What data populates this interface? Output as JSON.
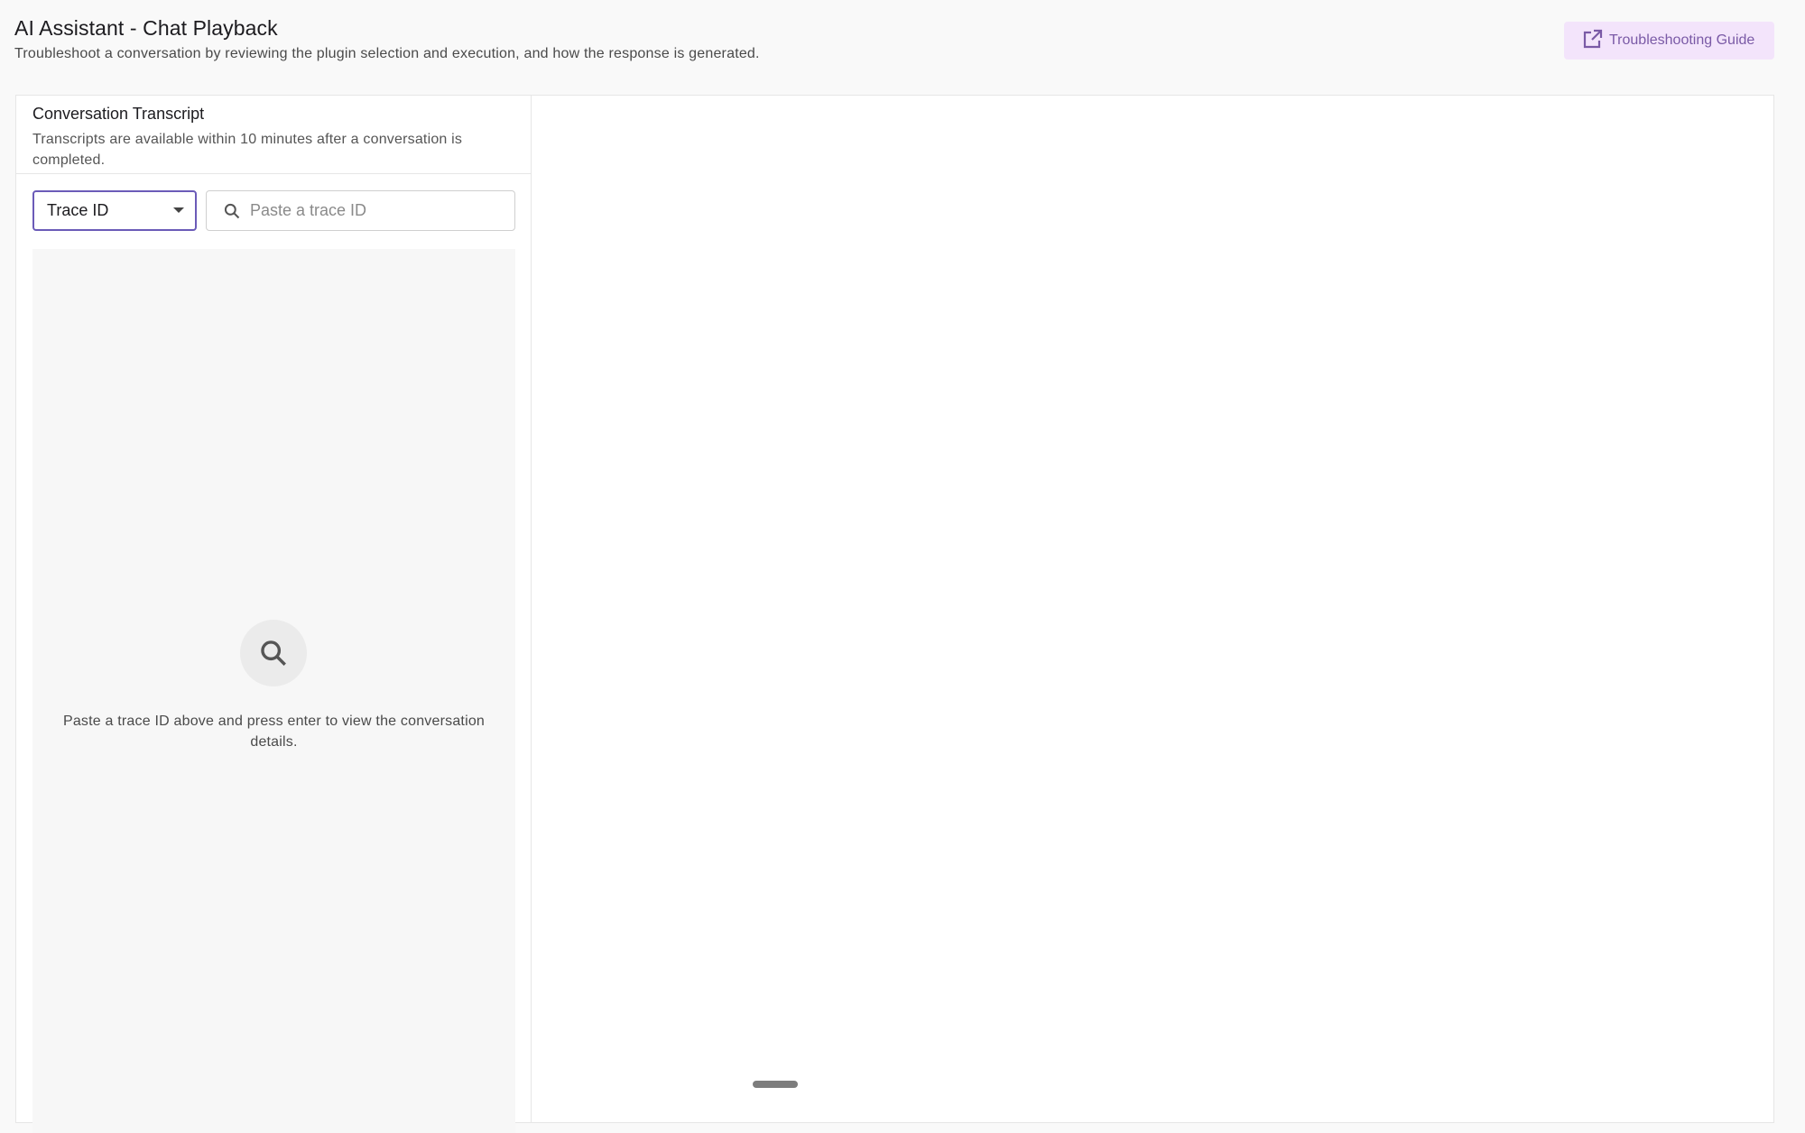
{
  "header": {
    "title": "AI Assistant - Chat Playback",
    "subtitle": "Troubleshoot a conversation by reviewing the plugin selection and execution, and how the response is generated.",
    "guide_button": {
      "label": "Troubleshooting Guide",
      "icon": "open-in-new-icon"
    }
  },
  "transcript": {
    "title": "Conversation Transcript",
    "description": "Transcripts are available within 10 minutes after a conversation is completed.",
    "filter": {
      "selected": "Trace ID",
      "icon": "chevron-down-icon"
    },
    "search": {
      "placeholder": "Paste a trace ID",
      "value": "",
      "icon": "search-icon"
    },
    "empty_state": {
      "icon": "search-icon",
      "message": "Paste a trace ID above and press enter to view the conversation details."
    }
  },
  "colors": {
    "accent": "#6b5bb8",
    "guide_bg": "#f3e4fb",
    "guide_text": "#7a5aa6",
    "page_bg": "#f9f9f9"
  }
}
